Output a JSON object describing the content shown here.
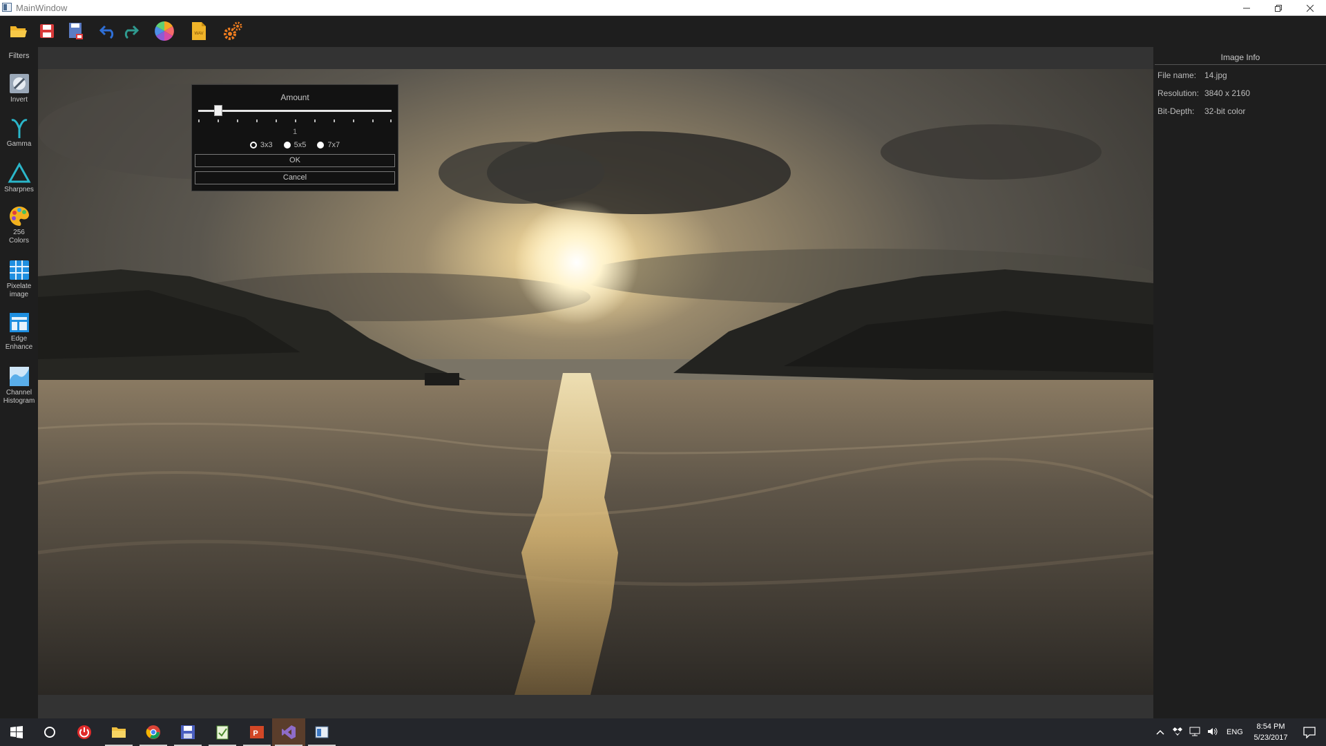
{
  "window": {
    "title": "MainWindow",
    "min_icon": "minimize-icon",
    "max_icon": "restore-icon",
    "close_icon": "close-icon"
  },
  "toolbar": {
    "items": [
      {
        "name": "open-folder-icon"
      },
      {
        "name": "save-icon"
      },
      {
        "name": "save-as-icon"
      },
      {
        "name": "undo-icon"
      },
      {
        "name": "redo-icon"
      },
      {
        "name": "color-wheel-icon"
      },
      {
        "name": "wav-file-icon",
        "label": "WAV"
      },
      {
        "name": "settings-gears-icon"
      }
    ]
  },
  "sidebar": {
    "heading": "Filters",
    "items": [
      {
        "label": "Invert",
        "icon": "invert-icon"
      },
      {
        "label": "Gamma",
        "icon": "gamma-icon"
      },
      {
        "label": "Sharpnes",
        "icon": "sharpness-triangle-icon"
      },
      {
        "label": "256\nColors",
        "icon": "palette-icon"
      },
      {
        "label": "Pixelate\nimage",
        "icon": "pixelate-grid-icon"
      },
      {
        "label": "Edge\nEnhance",
        "icon": "edge-enhance-icon"
      },
      {
        "label": "Channel\nHistogram",
        "icon": "histogram-icon"
      }
    ]
  },
  "dialog": {
    "title": "Amount",
    "slider_value": "1",
    "slider_fraction": 0.1,
    "radio_options": [
      "3x3",
      "5x5",
      "7x7"
    ],
    "selected": "3x3",
    "ok_label": "OK",
    "cancel_label": "Cancel"
  },
  "info_panel": {
    "heading": "Image Info",
    "rows": [
      {
        "key": "File name:",
        "value": "14.jpg"
      },
      {
        "key": "Resolution:",
        "value": "3840 x 2160"
      },
      {
        "key": "Bit-Depth:",
        "value": "32-bit color"
      }
    ]
  },
  "taskbar": {
    "apps": [
      "start-icon",
      "cortana-icon",
      "power-icon",
      "file-explorer-icon",
      "chrome-icon",
      "save-app-icon",
      "notepad-icon",
      "powerpoint-icon",
      "visual-studio-icon",
      "app-window-icon"
    ],
    "language": "ENG",
    "time": "8:54 PM",
    "date": "5/23/2017"
  }
}
